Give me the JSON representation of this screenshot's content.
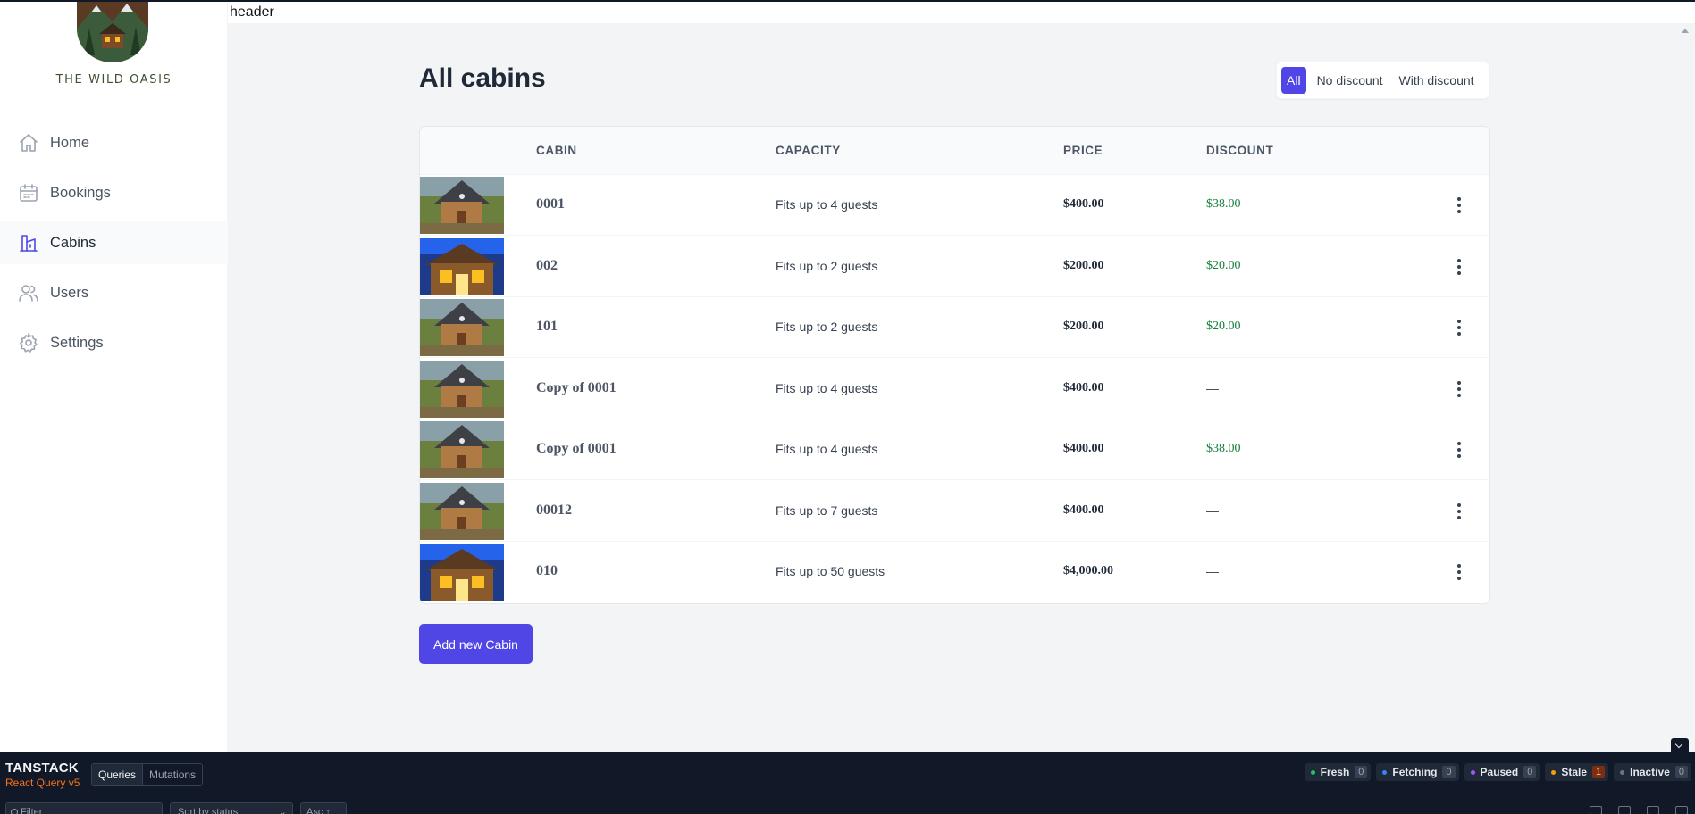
{
  "brand": {
    "name": "THE WILD OASIS"
  },
  "header": {
    "text": "header"
  },
  "nav": [
    {
      "label": "Home",
      "icon": "home-icon",
      "active": false
    },
    {
      "label": "Bookings",
      "icon": "calendar-icon",
      "active": false
    },
    {
      "label": "Cabins",
      "icon": "cabin-icon",
      "active": true
    },
    {
      "label": "Users",
      "icon": "users-icon",
      "active": false
    },
    {
      "label": "Settings",
      "icon": "gear-icon",
      "active": false
    }
  ],
  "page": {
    "title": "All cabins"
  },
  "filter": {
    "all": "All",
    "no_discount": "No discount",
    "with_discount": "With discount",
    "active": "All"
  },
  "table": {
    "headers": {
      "cabin": "CABIN",
      "capacity": "CAPACITY",
      "price": "PRICE",
      "discount": "DISCOUNT"
    },
    "rows": [
      {
        "name": "0001",
        "capacity": "Fits up to 4 guests",
        "price": "$400.00",
        "discount": "$38.00",
        "image": "cabin-a"
      },
      {
        "name": "002",
        "capacity": "Fits up to 2 guests",
        "price": "$200.00",
        "discount": "$20.00",
        "image": "cabin-b"
      },
      {
        "name": "101",
        "capacity": "Fits up to 2 guests",
        "price": "$200.00",
        "discount": "$20.00",
        "image": "cabin-a"
      },
      {
        "name": "Copy of 0001",
        "capacity": "Fits up to 4 guests",
        "price": "$400.00",
        "discount": "—",
        "image": "cabin-a"
      },
      {
        "name": "Copy of 0001",
        "capacity": "Fits up to 4 guests",
        "price": "$400.00",
        "discount": "$38.00",
        "image": "cabin-a"
      },
      {
        "name": "00012",
        "capacity": "Fits up to 7 guests",
        "price": "$400.00",
        "discount": "—",
        "image": "cabin-a"
      },
      {
        "name": "010",
        "capacity": "Fits up to 50 guests",
        "price": "$4,000.00",
        "discount": "—",
        "image": "cabin-b"
      }
    ]
  },
  "actions": {
    "add_cabin": "Add new Cabin"
  },
  "colors": {
    "accent": "#4f46e5",
    "discount": "#15803d",
    "devtools_bg": "#111827"
  },
  "devtools": {
    "brand_top": "TANSTACK",
    "brand_bottom": "React Query v5",
    "tabs": [
      "Queries",
      "Mutations"
    ],
    "stats": [
      {
        "label": "Fresh",
        "count": "0",
        "color": "#22c55e"
      },
      {
        "label": "Fetching",
        "count": "0",
        "color": "#3b82f6"
      },
      {
        "label": "Paused",
        "count": "0",
        "color": "#a855f7"
      },
      {
        "label": "Stale",
        "count": "1",
        "color": "#f59e0b"
      },
      {
        "label": "Inactive",
        "count": "0",
        "color": "#6b7280"
      }
    ],
    "filter_placeholder": "Filter",
    "sort_label": "Sort by status",
    "order_label": "Asc ↑"
  }
}
